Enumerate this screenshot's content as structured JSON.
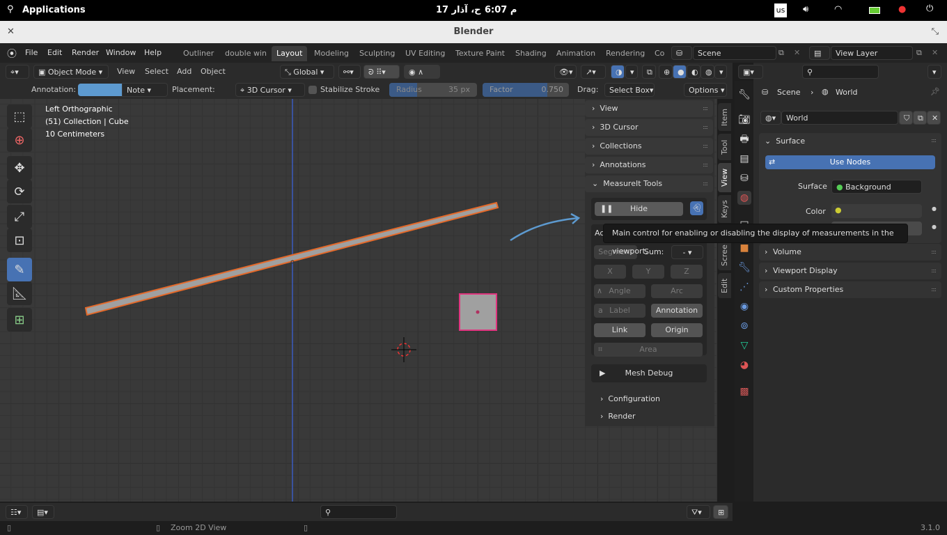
{
  "system_bar": {
    "apps_label": "Applications",
    "date": "ح، آذار 17",
    "time": "6:07 م",
    "keyboard_layout": "us"
  },
  "window": {
    "title": "Blender"
  },
  "menu": {
    "items": [
      "File",
      "Edit",
      "Render",
      "Window",
      "Help"
    ]
  },
  "workspaces": {
    "tabs": [
      "Outliner",
      "double win",
      "Layout",
      "Modeling",
      "Sculpting",
      "UV Editing",
      "Texture Paint",
      "Shading",
      "Animation",
      "Rendering",
      "Co"
    ],
    "active": "Layout"
  },
  "scene_selector": {
    "value": "Scene"
  },
  "view_layer_selector": {
    "value": "View Layer"
  },
  "viewport_header": {
    "mode": "Object Mode",
    "menus": [
      "View",
      "Select",
      "Add",
      "Object"
    ],
    "orientation": "Global"
  },
  "tool_settings": {
    "annotation_label": "Annotation:",
    "annotation_color": "#5d9ad0",
    "layer": "Note",
    "placement_label": "Placement:",
    "placement": "3D Cursor",
    "stabilize_label": "Stabilize Stroke",
    "radius_label": "Radius",
    "radius_value": "35 px",
    "factor_label": "Factor",
    "factor_value": "0.750",
    "drag_label": "Drag:",
    "drag_value": "Select Box",
    "options_label": "Options"
  },
  "viewport": {
    "view_name": "Left Orthographic",
    "collection_info": "(51) Collection | Cube",
    "scale_info": "10 Centimeters"
  },
  "npanel": {
    "sections": [
      "View",
      "3D Cursor",
      "Collections",
      "Annotations"
    ],
    "measureit_title": "MeasureIt Tools",
    "hide_label": "Hide",
    "add_label": "Ac",
    "segment_label": "Segment",
    "sum_label": "Sum:",
    "sum_value": "-",
    "x": "X",
    "y": "Y",
    "z": "Z",
    "angle": "Angle",
    "arc": "Arc",
    "label": "Label",
    "annotation": "Annotation",
    "link": "Link",
    "origin": "Origin",
    "area": "Area",
    "mesh_debug": "Mesh Debug",
    "configuration": "Configuration",
    "render": "Render"
  },
  "side_tabs": [
    "Item",
    "Tool",
    "View",
    "Keys",
    "Scree",
    "Edit"
  ],
  "tooltip": "Main control for enabling or disabling the display of measurements in the viewport.",
  "properties": {
    "breadcrumb_scene": "Scene",
    "breadcrumb_world": "World",
    "world_name": "World",
    "surface_panel": "Surface",
    "use_nodes": "Use Nodes",
    "surface_label": "Surface",
    "surface_value": "Background",
    "color_label": "Color",
    "panels": [
      "Volume",
      "Viewport Display",
      "Custom Properties"
    ],
    "accent": "#4772b3"
  },
  "status_bar": {
    "hint": "Zoom 2D View",
    "version": "3.1.0"
  }
}
